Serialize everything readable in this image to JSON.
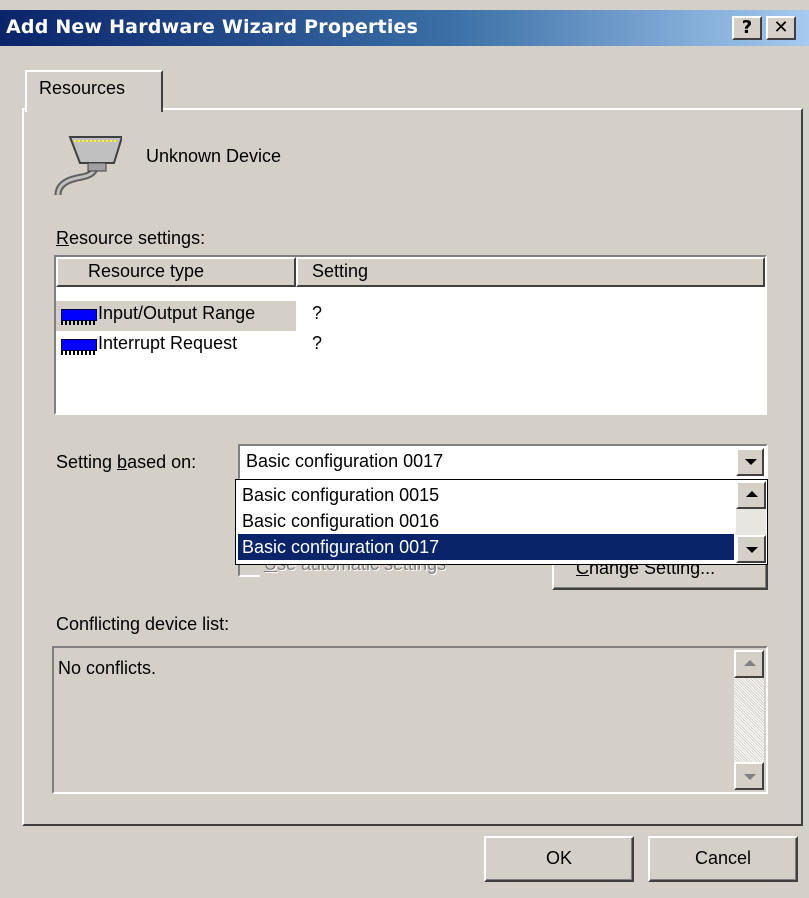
{
  "window": {
    "title": "Add New Hardware Wizard Properties",
    "help_btn": "?",
    "close_btn": "✕"
  },
  "tab": {
    "label": "Resources"
  },
  "device": {
    "name": "Unknown Device"
  },
  "resource_settings": {
    "label_prefix": "R",
    "label_rest": "esource settings:",
    "columns": [
      "Resource type",
      "Setting"
    ],
    "rows": [
      {
        "type": "Input/Output Range",
        "setting": "?"
      },
      {
        "type": "Interrupt Request",
        "setting": "?"
      }
    ]
  },
  "setting_based_on": {
    "label_a": "Setting ",
    "label_b": "b",
    "label_c": "ased on:",
    "value": "Basic configuration 0017",
    "options": [
      "Basic configuration 0015",
      "Basic configuration 0016",
      "Basic configuration 0017"
    ],
    "selected_index": 2
  },
  "automatic": {
    "label_u": "U",
    "label_rest": "se automatic settings",
    "checked": false
  },
  "change_setting": {
    "u": "C",
    "rest": "hange Setting..."
  },
  "conflicts": {
    "label": "Conflicting device list:",
    "text": "No conflicts."
  },
  "buttons": {
    "ok": "OK",
    "cancel": "Cancel"
  }
}
